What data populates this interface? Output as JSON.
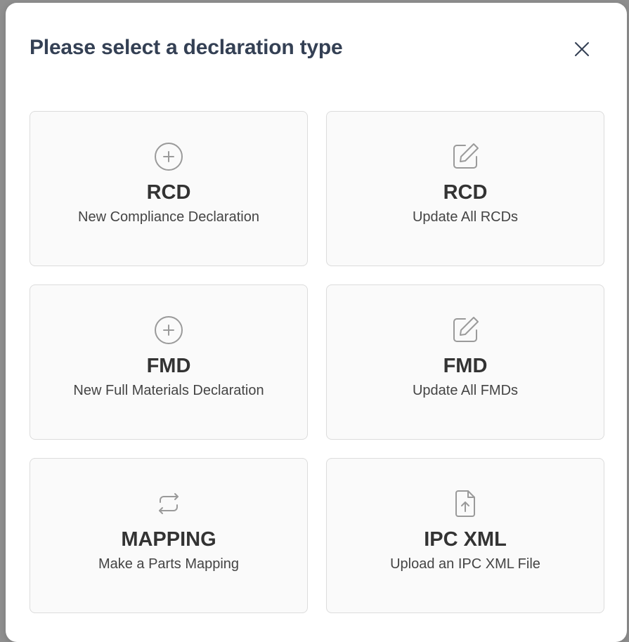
{
  "dialog": {
    "title": "Please select a declaration type",
    "close_icon": "close-icon"
  },
  "colors": {
    "backdrop": "#8f8f8f",
    "title": "#344054",
    "card_border": "#dcdcdc",
    "card_background": "#fafafa",
    "icon": "#9a9a9a"
  },
  "options": [
    {
      "icon": "plus-circle-icon",
      "title": "RCD",
      "subtitle": "New Compliance Declaration"
    },
    {
      "icon": "edit-icon",
      "title": "RCD",
      "subtitle": "Update All RCDs"
    },
    {
      "icon": "plus-circle-icon",
      "title": "FMD",
      "subtitle": "New Full Materials Declaration"
    },
    {
      "icon": "edit-icon",
      "title": "FMD",
      "subtitle": "Update All FMDs"
    },
    {
      "icon": "refresh-icon",
      "title": "MAPPING",
      "subtitle": "Make a Parts Mapping"
    },
    {
      "icon": "file-upload-icon",
      "title": "IPC XML",
      "subtitle": "Upload an IPC XML File"
    }
  ]
}
